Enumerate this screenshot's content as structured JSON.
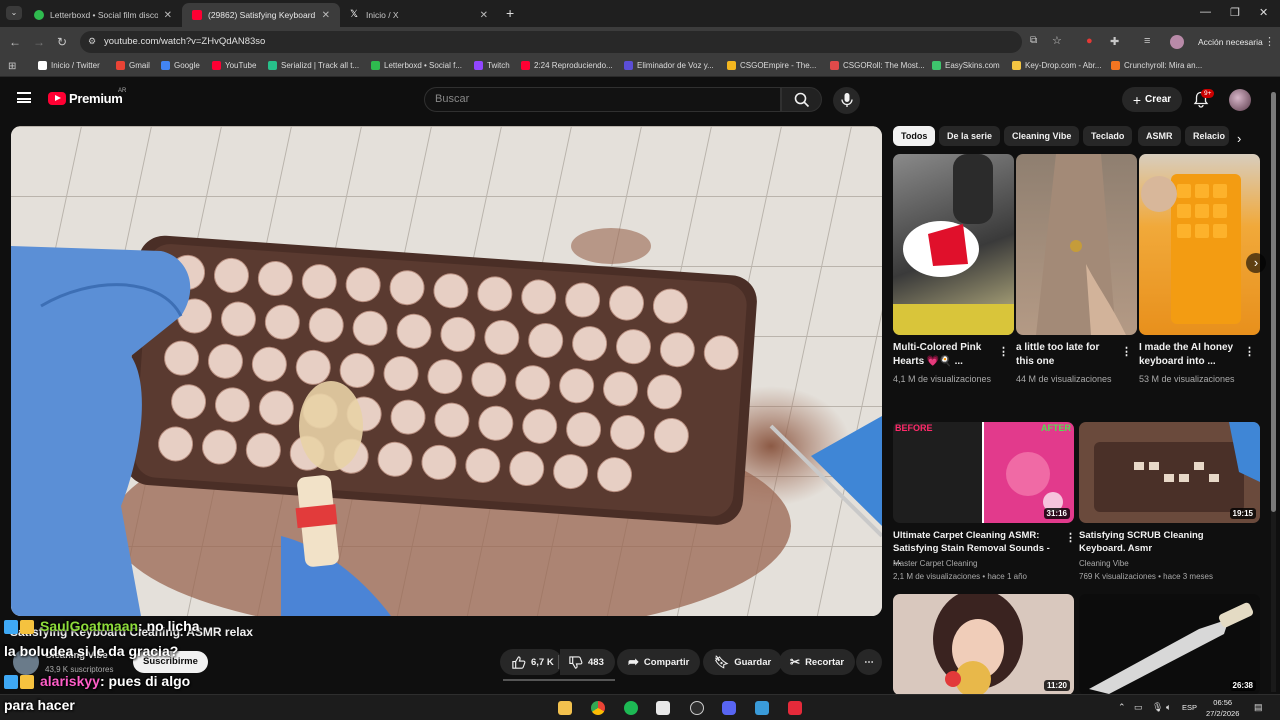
{
  "browser": {
    "tabs": [
      {
        "title": "Letterboxd • Social film discove",
        "favicon_color": "#2fbb4f",
        "active": false
      },
      {
        "title": "(29862) Satisfying Keyboard Cle",
        "favicon_color": "#ff0033",
        "active": true
      },
      {
        "title": "Inicio / X",
        "favicon_color": "#ffffff",
        "active": false
      }
    ],
    "new_tab_symbol": "+",
    "url": "youtube.com/watch?v=ZHvQdAN83so",
    "profile_action": "Acción necesaria",
    "bookmarks": [
      {
        "label": "Inicio / Twitter",
        "color": "#ffffff"
      },
      {
        "label": "Gmail",
        "color": "#ea4335"
      },
      {
        "label": "Google",
        "color": "#4285f4"
      },
      {
        "label": "YouTube",
        "color": "#ff0033"
      },
      {
        "label": "Serializd | Track all t...",
        "color": "#27c08a"
      },
      {
        "label": "Letterboxd • Social f...",
        "color": "#2fbb4f"
      },
      {
        "label": "Twitch",
        "color": "#9146ff"
      },
      {
        "label": "2:24 Reproduciendo...",
        "color": "#ff0033"
      },
      {
        "label": "Eliminador de Voz y...",
        "color": "#5b4ed6"
      },
      {
        "label": "CSGOEmpire - The...",
        "color": "#f3b61f"
      },
      {
        "label": "CSGORoll: The Most...",
        "color": "#e04a4a"
      },
      {
        "label": "EasySkins.com",
        "color": "#3ec46d"
      },
      {
        "label": "Key-Drop.com - Abr...",
        "color": "#f4c542"
      },
      {
        "label": "Crunchyroll: Mira an...",
        "color": "#f47521"
      }
    ]
  },
  "youtube": {
    "logo_text": "Premium",
    "region": "AR",
    "search_placeholder": "Buscar",
    "create_label": "Crear",
    "notif_count": "9+"
  },
  "video": {
    "title": "Satisfying Keyboard Cleaning. ASMR relax",
    "channel": "Cleaning Vibe",
    "subscribers": "43,9 K suscriptores",
    "subscribe_label": "Suscribirme",
    "likes": "6,7 K",
    "dislikes": "483",
    "share_label": "Compartir",
    "save_label": "Guardar",
    "clip_label": "Recortar"
  },
  "chat": {
    "msg1_user": "SaulGoatmaan",
    "msg1_text": ": no licha",
    "msg1_cont": "la boludea si le da gracia?",
    "msg2_user": "alariskyy",
    "msg2_text": ": pues di algo",
    "msg2_cont": "para hacer"
  },
  "chips": [
    "Todos",
    "De la serie",
    "Cleaning Vibe",
    "Teclado",
    "ASMR",
    "Relacio"
  ],
  "shorts": [
    {
      "title": "Multi-Colored Pink Hearts 💗🍳 ...",
      "views": "4,1 M de visualizaciones"
    },
    {
      "title": "a little too late for this one",
      "views": "44 M de visualizaciones"
    },
    {
      "title": "I made the AI honey keyboard into ...",
      "views": "53 M de visualizaciones"
    }
  ],
  "videos": [
    {
      "title": "Ultimate Carpet Cleaning ASMR: Satisfying Stain Removal Sounds - ...",
      "channel": "Master Carpet Cleaning",
      "meta": "2,1 M de visualizaciones • hace 1 año",
      "duration": "31:16",
      "before": "BEFORE",
      "after": "AFTER"
    },
    {
      "title": "Satisfying SCRUB Cleaning Keyboard. Asmr",
      "channel": "Cleaning Vibe",
      "meta": "769 K visualizaciones • hace 3 meses",
      "duration": "19:15"
    },
    {
      "duration": "11:20"
    },
    {
      "duration": "26:38"
    }
  ],
  "taskbar": {
    "lang": "ESP",
    "time": "06:56",
    "date": "27/2/2026"
  }
}
